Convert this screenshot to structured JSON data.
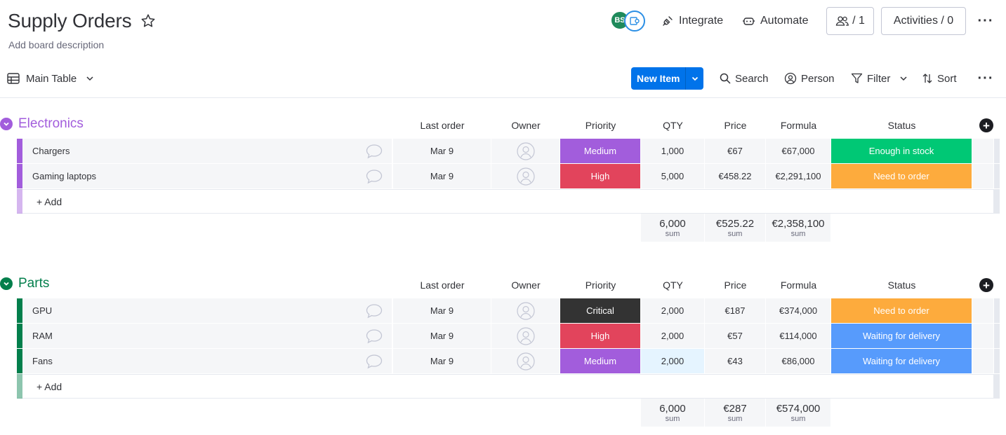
{
  "board": {
    "title": "Supply Orders",
    "description": "Add board description"
  },
  "header": {
    "avatar_initials": "BS",
    "integrate_label": "Integrate",
    "automate_label": "Automate",
    "members_label": "/ 1",
    "activities_label": "Activities / 0"
  },
  "toolbar": {
    "view_label": "Main Table",
    "new_item_label": "New Item",
    "search_label": "Search",
    "person_label": "Person",
    "filter_label": "Filter",
    "sort_label": "Sort"
  },
  "columns": {
    "last_order": "Last order",
    "owner": "Owner",
    "priority": "Priority",
    "qty": "QTY",
    "price": "Price",
    "formula": "Formula",
    "status": "Status"
  },
  "colors": {
    "electronics": "#a25ddc",
    "parts": "#037f4c",
    "medium": "#a25ddc",
    "high": "#e2445c",
    "critical": "#333333",
    "enough_in_stock": "#00c875",
    "need_to_order": "#fdab3d",
    "waiting_for_delivery": "#579bfc",
    "primary_button": "#0073ea"
  },
  "groups": [
    {
      "name": "Electronics",
      "add_label": "+ Add",
      "items": [
        {
          "name": "Chargers",
          "last_order": "Mar 9",
          "priority": "Medium",
          "qty": "1,000",
          "price": "€67",
          "formula": "€67,000",
          "status": "Enough in stock"
        },
        {
          "name": "Gaming laptops",
          "last_order": "Mar 9",
          "priority": "High",
          "qty": "5,000",
          "price": "€458.22",
          "formula": "€2,291,100",
          "status": "Need to order"
        }
      ],
      "sums": {
        "qty": "6,000",
        "price": "€525.22",
        "formula": "€2,358,100",
        "label": "sum"
      }
    },
    {
      "name": "Parts",
      "add_label": "+ Add",
      "items": [
        {
          "name": "GPU",
          "last_order": "Mar 9",
          "priority": "Critical",
          "qty": "2,000",
          "price": "€187",
          "formula": "€374,000",
          "status": "Need to order"
        },
        {
          "name": "RAM",
          "last_order": "Mar 9",
          "priority": "High",
          "qty": "2,000",
          "price": "€57",
          "formula": "€114,000",
          "status": "Waiting for delivery"
        },
        {
          "name": "Fans",
          "last_order": "Mar 9",
          "priority": "Medium",
          "qty": "2,000",
          "price": "€43",
          "formula": "€86,000",
          "status": "Waiting for delivery"
        }
      ],
      "sums": {
        "qty": "6,000",
        "price": "€287",
        "formula": "€574,000",
        "label": "sum"
      }
    }
  ]
}
